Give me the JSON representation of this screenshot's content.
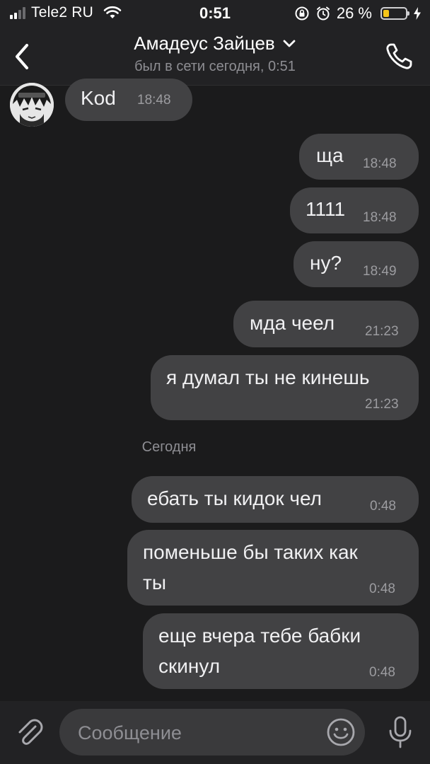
{
  "status_bar": {
    "carrier": "Tele2 RU",
    "time": "0:51",
    "battery_percent": "26 %",
    "battery_level": 0.26,
    "battery_color": "#f5c518"
  },
  "header": {
    "contact_name": "Амадеус Зайцев",
    "last_seen": "был в сети сегодня, 0:51",
    "icons": [
      "chevron-left-icon",
      "chevron-down-icon",
      "phone-icon"
    ]
  },
  "messages": [
    {
      "text": "Kod",
      "time": "18:48",
      "direction": "incoming"
    },
    {
      "text": "ща",
      "time": "18:48",
      "direction": "outgoing"
    },
    {
      "text": "1111",
      "time": "18:48",
      "direction": "outgoing"
    },
    {
      "text": "ну?",
      "time": "18:49",
      "direction": "outgoing"
    },
    {
      "text": "мда чеел",
      "time": "21:23",
      "direction": "outgoing"
    },
    {
      "text": "я думал ты не кинешь",
      "time": "21:23",
      "direction": "outgoing"
    },
    {
      "text": "ебать ты кидок чел",
      "time": "0:48",
      "direction": "outgoing"
    },
    {
      "line1": "поменьше бы таких как",
      "line2": "ты",
      "time": "0:48",
      "direction": "outgoing"
    },
    {
      "line1": "еще вчера тебе бабки",
      "line2": "скинул",
      "time": "0:48",
      "direction": "outgoing"
    }
  ],
  "date_separator": "Сегодня",
  "input": {
    "placeholder": "Сообщение",
    "value": "",
    "icons": [
      "paperclip-icon",
      "emoji-icon",
      "microphone-icon"
    ]
  },
  "colors": {
    "background": "#1b1b1c",
    "bubble": "#424244",
    "bar": "#222224"
  }
}
